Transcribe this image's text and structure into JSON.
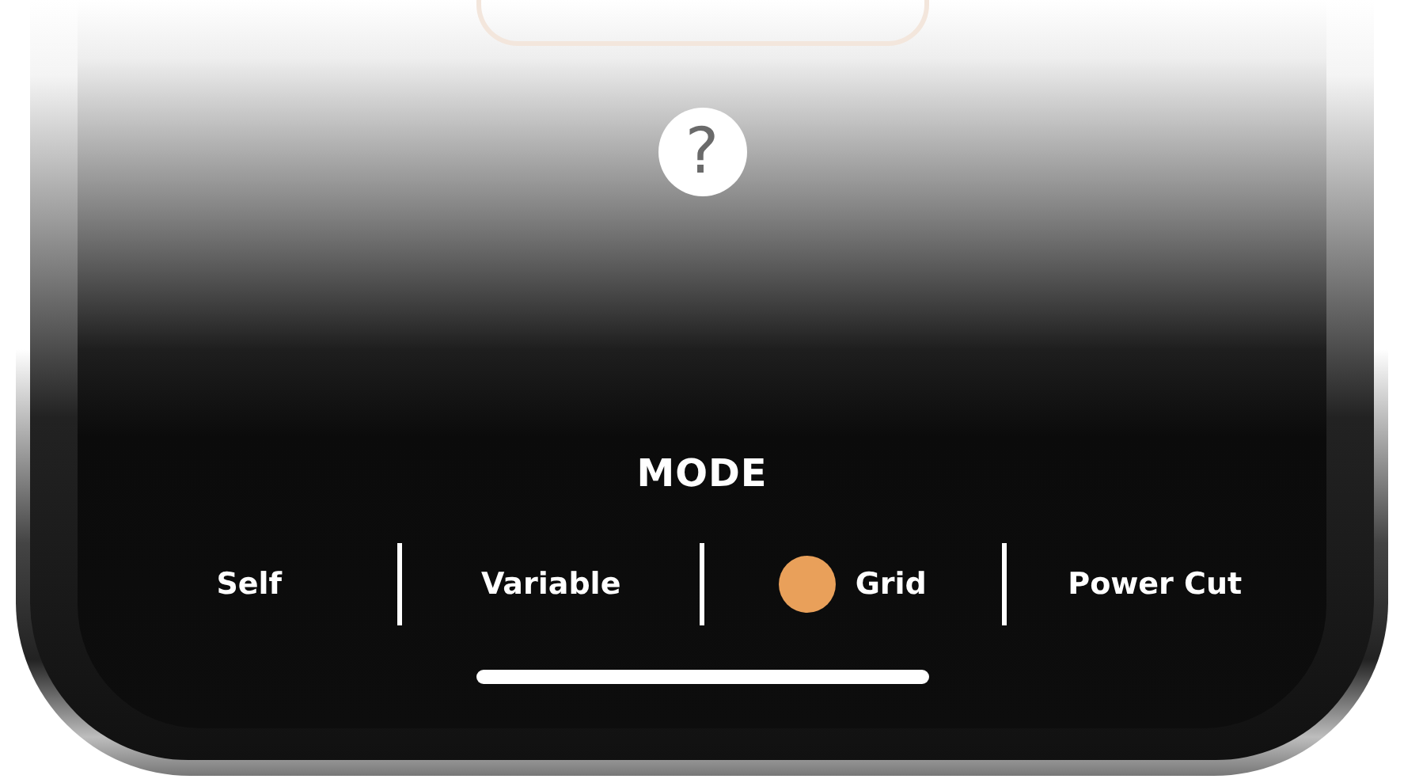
{
  "help_button": {
    "label": "?"
  },
  "mode": {
    "title": "MODE",
    "options": [
      {
        "label": "Self",
        "selected": false
      },
      {
        "label": "Variable",
        "selected": false
      },
      {
        "label": "Grid",
        "selected": true
      },
      {
        "label": "Power Cut",
        "selected": false
      }
    ]
  }
}
